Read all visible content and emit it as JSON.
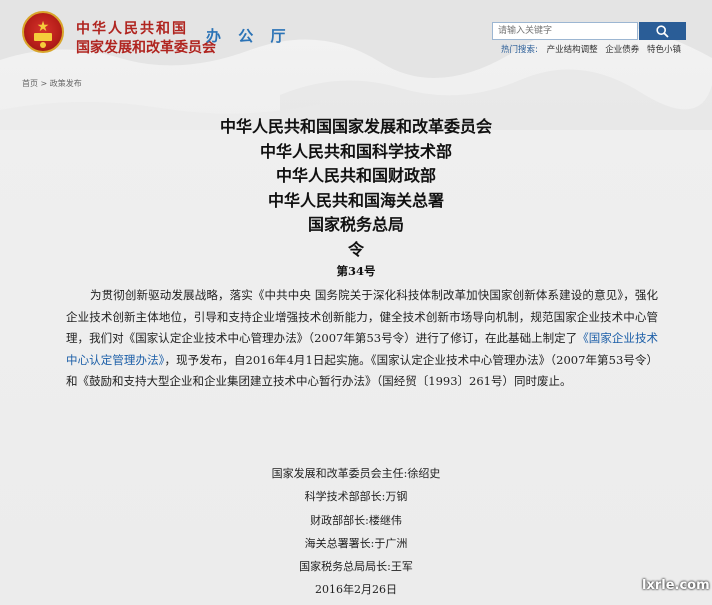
{
  "header": {
    "org_line1": "中华人民共和国",
    "org_line2": "国家发展和改革委员会",
    "office": "办 公 厅",
    "search_placeholder": "请输入关键字",
    "hot_label": "热门搜索:",
    "hot_links": [
      "产业结构调整",
      "企业债券",
      "特色小镇"
    ]
  },
  "breadcrumb": "首页 > 政策发布",
  "document": {
    "titles": [
      "中华人民共和国国家发展和改革委员会",
      "中华人民共和国科学技术部",
      "中华人民共和国财政部",
      "中华人民共和国海关总署",
      "国家税务总局",
      "令"
    ],
    "order_no": "第34号",
    "paragraph_part1": "为贯彻创新驱动发展战略，落实《中共中央 国务院关于深化科技体制改革加快国家创新体系建设的意见》，强化企业技术创新主体地位，引导和支持企业增强技术创新能力，健全技术创新市场导向机制，规范国家企业技术中心管理，我们对《国家认定企业技术中心管理办法》（2007年第53号令）进行了修订，在此基础上制定了",
    "paragraph_link": "《国家企业技术中心认定管理办法》",
    "paragraph_part2": "，现予发布，自2016年4月1日起实施。《国家认定企业技术中心管理办法》（2007年第53号令）和《鼓励和支持大型企业和企业集团建立技术中心暂行办法》（国经贸〔1993〕261号）同时废止。",
    "signatures": [
      "国家发展和改革委员会主任:徐绍史",
      "科学技术部部长:万钢",
      "财政部部长:楼继伟",
      "海关总署署长:于广洲",
      "国家税务总局局长:王军",
      "2016年2月26日"
    ]
  },
  "watermark": "lxrle.com",
  "colors": {
    "brand_red": "#b0241f",
    "office_blue": "#2b73b6",
    "search_button": "#2a5d97",
    "link_blue": "#1c5fa8"
  }
}
